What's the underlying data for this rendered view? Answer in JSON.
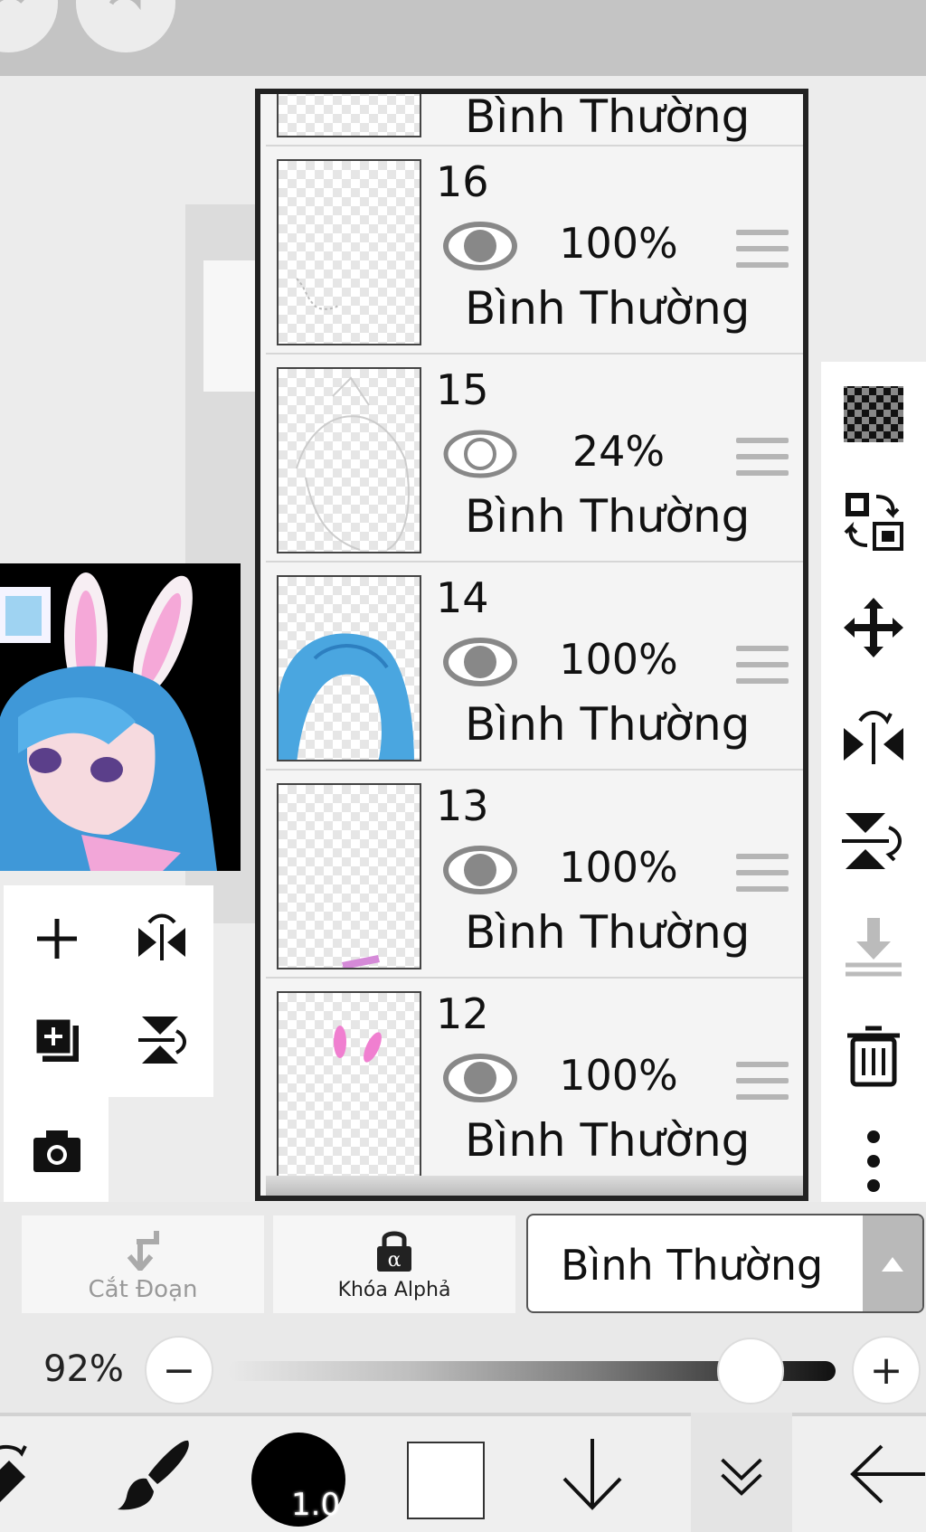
{
  "canvas": {
    "preview_alt": "artwork preview"
  },
  "layers": {
    "items": [
      {
        "number": "",
        "opacity": "",
        "blend": "Bình Thường",
        "visible": true,
        "partial": true
      },
      {
        "number": "16",
        "opacity": "100%",
        "blend": "Bình Thường",
        "visible": true
      },
      {
        "number": "15",
        "opacity": "24%",
        "blend": "Bình Thường",
        "visible": false
      },
      {
        "number": "14",
        "opacity": "100%",
        "blend": "Bình Thường",
        "visible": true
      },
      {
        "number": "13",
        "opacity": "100%",
        "blend": "Bình Thường",
        "visible": true
      },
      {
        "number": "12",
        "opacity": "100%",
        "blend": "Bình Thường",
        "visible": true
      }
    ]
  },
  "controls": {
    "clipping_label": "Cắt Đoạn",
    "alpha_lock_label": "Khóa Alphả",
    "blend_mode": "Bình Thường",
    "layer_opacity": "92%",
    "layer_opacity_value": 0.92,
    "minus": "−",
    "plus": "+"
  },
  "toolbar": {
    "brush_size": "1.0",
    "primary_color": "#ffffff"
  },
  "colors": {
    "hair": "#4aa6e0",
    "bunny_ear": "#f5a8d8",
    "knob": "#ffffff",
    "panel_border": "#222222"
  }
}
